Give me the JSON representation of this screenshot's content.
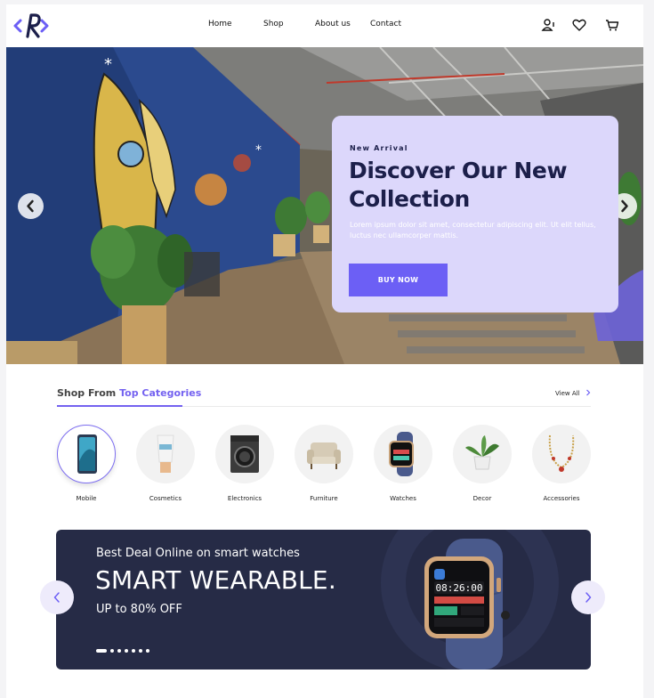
{
  "header": {
    "logo_alt": "R",
    "nav": [
      "Home",
      "Shop",
      "About us",
      "Contact"
    ],
    "icons": [
      "user-add-icon",
      "heart-icon",
      "cart-icon"
    ]
  },
  "hero": {
    "eyebrow": "New Arrival",
    "title": "Discover Our New Collection",
    "description": "Lorem ipsum dolor sit amet, consectetur adipiscing elit. Ut elit tellus, luctus nec ullamcorper mattis.",
    "cta": "BUY NOW",
    "arrows": [
      "chevron-left-icon",
      "chevron-right-icon"
    ]
  },
  "categories": {
    "heading_prefix": "Shop From ",
    "heading_accent": "Top Categories",
    "view_all": "View All",
    "items": [
      {
        "label": "Mobile",
        "icon": "mobile-phone-icon",
        "active": true
      },
      {
        "label": "Cosmetics",
        "icon": "cosmetics-tube-icon"
      },
      {
        "label": "Electronics",
        "icon": "washing-machine-icon"
      },
      {
        "label": "Furniture",
        "icon": "armchair-icon"
      },
      {
        "label": "Watches",
        "icon": "smartwatch-icon"
      },
      {
        "label": "Decor",
        "icon": "potted-plant-icon"
      },
      {
        "label": "Accessories",
        "icon": "necklace-icon"
      }
    ]
  },
  "banner": {
    "subtitle": "Best Deal Online on smart watches",
    "title": "SMART WEARABLE.",
    "offer": "UP to 80% OFF",
    "watch_time": "08:26:00",
    "slide_count": 7,
    "active_slide": 0,
    "colors": {
      "background": "#262b46",
      "accent": "#6c5ff5"
    }
  }
}
